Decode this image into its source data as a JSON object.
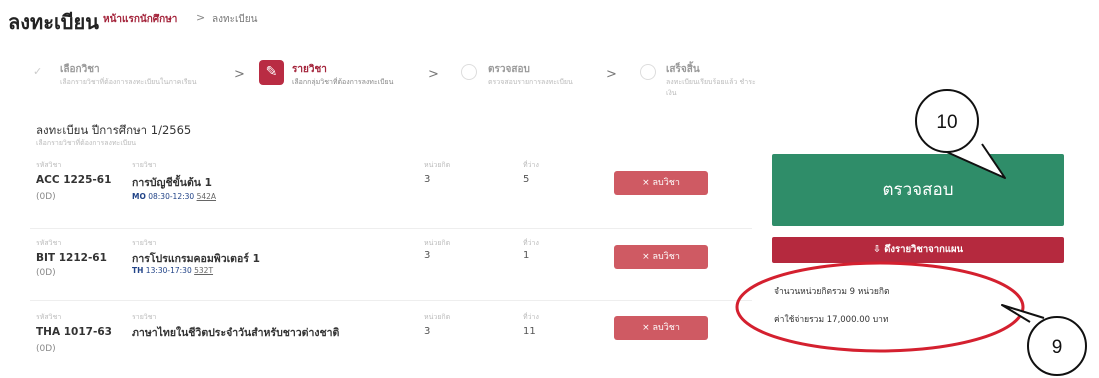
{
  "header": {
    "title": "ลงทะเบียน",
    "breadcrumb_home": "หน้าแรกนักศึกษา",
    "breadcrumb_sep": ">",
    "breadcrumb_current": "ลงทะเบียน"
  },
  "steps": [
    {
      "title": "เลือกวิชา",
      "sub": "เลือกรายวิชาที่ต้องการลงทะเบียนในภาคเรียน",
      "state": "done"
    },
    {
      "title": "รายวิชา",
      "sub": "เลือกกลุ่มวิชาที่ต้องการลงทะเบียน",
      "state": "active",
      "icon": "edit-icon"
    },
    {
      "title": "ตรวจสอบ",
      "sub": "ตรวจสอบรายการลงทะเบียน",
      "state": "pending"
    },
    {
      "title": "เสร็จสิ้น",
      "sub": "ลงทะเบียนเรียบร้อยแล้ว ชำระเงิน",
      "state": "pending"
    }
  ],
  "step_separator": ">",
  "section": {
    "title": "ลงทะเบียน ปีการศึกษา 1/2565",
    "subtitle": "เลือกรายวิชาที่ต้องการลงทะเบียน"
  },
  "labels": {
    "code": "รหัสวิชา",
    "name": "รายวิชา",
    "credits": "หน่วยกิต",
    "seats": "ที่ว่าง"
  },
  "courses": [
    {
      "code": "ACC 1225-61",
      "group": "(0D)",
      "name": "การบัญชีขั้นต้น 1",
      "schedule_day": "MO",
      "schedule_time": "08:30-12:30",
      "room": "542A",
      "credits": "3",
      "seats": "5"
    },
    {
      "code": "BIT 1212-61",
      "group": "(0D)",
      "name": "การโปรแกรมคอมพิวเตอร์ 1",
      "schedule_day": "TH",
      "schedule_time": "13:30-17:30",
      "room": "532T",
      "credits": "3",
      "seats": "1"
    },
    {
      "code": "THA 1017-63",
      "group": "(0D)",
      "name": "ภาษาไทยในชีวิตประจำวันสำหรับชาวต่างชาติ",
      "schedule_day": "",
      "schedule_time": "",
      "room": "",
      "credits": "3",
      "seats": "11"
    }
  ],
  "remove_button": "× ลบวิชา",
  "panel": {
    "check_button": "ตรวจสอบ",
    "drop_button": "⇩ ดึงรายวิชาจากแผน",
    "credits_summary": "จำนวนหน่วยกิตรวม 9 หน่วยกิต",
    "cost_summary": "ค่าใช้จ่ายรวม 17,000.00 บาท"
  },
  "annotations": [
    {
      "number": "10",
      "target": "check-button"
    },
    {
      "number": "9",
      "target": "summary-text"
    }
  ],
  "colors": {
    "brand": "#b92c43",
    "check": "#2f8d69",
    "remove": "#cf5a63",
    "annotation": "#d4202f"
  }
}
